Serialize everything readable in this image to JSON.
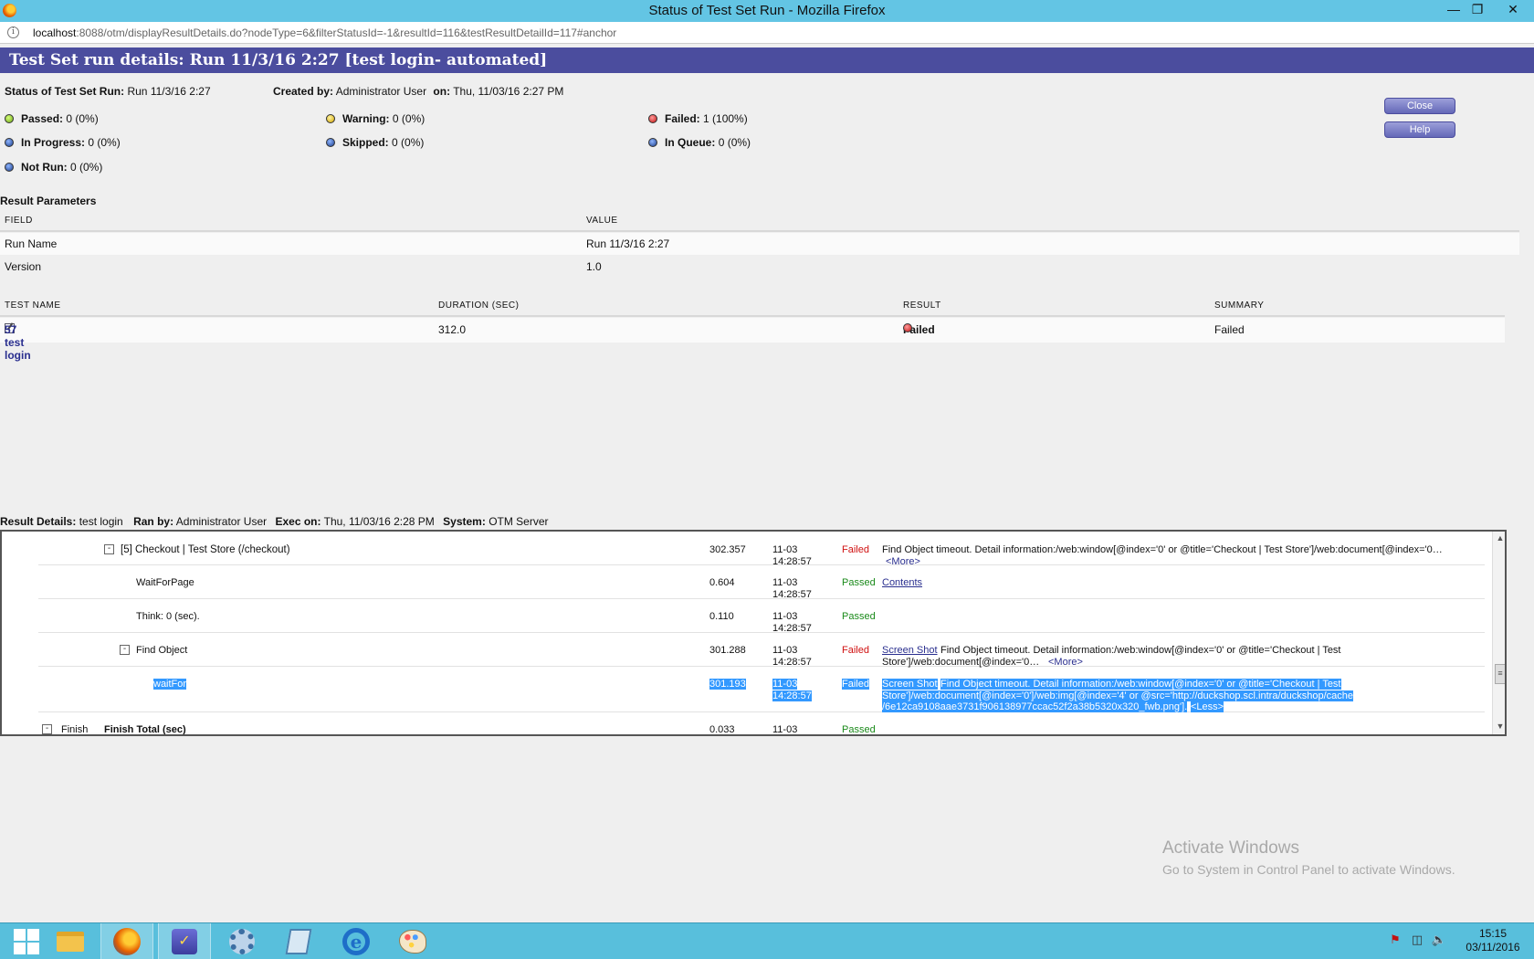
{
  "window": {
    "title": "Status of Test Set Run - Mozilla Firefox",
    "url_host": "localhost",
    "url_rest": ":8088/otm/displayResultDetails.do?nodeType=6&filterStatusId=-1&resultId=116&testResultDetailId=117#anchor"
  },
  "page": {
    "heading": "Test Set run details: Run 11/3/16 2:27 [test login- automated]",
    "status_label": "Status of Test Set Run:",
    "status_value": "Run 11/3/16 2:27",
    "created_label": "Created by:",
    "created_value": "Administrator User",
    "on_label": "on:",
    "on_value": "Thu, 11/03/16 2:27 PM"
  },
  "stats": [
    {
      "label": "Passed:",
      "value": "0 (0%)",
      "color": "#6fa818"
    },
    {
      "label": "Warning:",
      "value": "0 (0%)",
      "color": "#d2a400"
    },
    {
      "label": "Failed:",
      "value": "1 (100%)",
      "color": "#c21313"
    },
    {
      "label": "In Progress:",
      "value": "0 (0%)",
      "color": "#1b3d8a"
    },
    {
      "label": "Skipped:",
      "value": "0 (0%)",
      "color": "#1b3d8a"
    },
    {
      "label": "In Queue:",
      "value": "0 (0%)",
      "color": "#1b3d8a"
    },
    {
      "label": "Not Run:",
      "value": "0 (0%)",
      "color": "#1b3d8a"
    }
  ],
  "buttons": {
    "close": "Close",
    "help": "Help"
  },
  "params": {
    "title": "Result Parameters",
    "headers": [
      "FIELD",
      "VALUE"
    ],
    "rows": [
      {
        "field": "Run Name",
        "value": "Run 11/3/16 2:27"
      },
      {
        "field": "Version",
        "value": "1.0"
      }
    ]
  },
  "tests": {
    "headers": [
      "TEST NAME",
      "DURATION (SEC)",
      "RESULT",
      "SUMMARY"
    ],
    "rows": [
      {
        "name": "57 test login",
        "duration": "312.0",
        "result": "Failed",
        "summary": "Failed"
      }
    ]
  },
  "result_details": {
    "details_label": "Result Details:",
    "details_value": "test login",
    "ran_label": "Ran by:",
    "ran_value": "Administrator User",
    "exec_label": "Exec on:",
    "exec_value": "Thu, 11/03/16 2:28 PM",
    "system_label": "System:",
    "system_value": "OTM Server",
    "rows": [
      {
        "toggle": "-",
        "name": "[5] Checkout | Test Store (/checkout)",
        "duration": "302.357",
        "date": "11-03",
        "time": "14:28:57",
        "status": "Failed",
        "message": "Find Object timeout. Detail information:/web:window[@index='0' or @title='Checkout | Test Store']/web:document[@index='0…",
        "more": "<More>"
      },
      {
        "name": "WaitForPage",
        "duration": "0.604",
        "date": "11-03",
        "time": "14:28:57",
        "status": "Passed",
        "link": "Contents"
      },
      {
        "name": "Think: 0 (sec).",
        "duration": "0.110",
        "date": "11-03",
        "time": "14:28:57",
        "status": "Passed"
      },
      {
        "toggle": "-",
        "name": "Find Object",
        "duration": "301.288",
        "date": "11-03",
        "time": "14:28:57",
        "status": "Failed",
        "link": "Screen Shot",
        "message_l1": "Find Object timeout. Detail information:/web:window[@index='0' or @title='Checkout | Test",
        "message_l2": "Store']/web:document[@index='0…",
        "more": "<More>"
      },
      {
        "name": "waitFor",
        "duration": "301.193",
        "date": "11-03",
        "time": "14:28:57",
        "status": "Failed",
        "link": "Screen Shot",
        "message_l1": "Find Object timeout. Detail information:/web:window[@index='0' or @title='Checkout | Test",
        "message_l2": "Store']/web:document[@index='0']/web:img[@index='4' or @src='http://duckshop.scl.intra/duckshop/cache",
        "message_l3": "/6e12ca9108aae3731f906138977ccac52f2a38b5320x320_fwb.png'].",
        "less": "<Less>"
      },
      {
        "toggle": "-",
        "label": "Finish",
        "name": "Finish Total (sec)",
        "duration": "0.033",
        "date": "11-03",
        "status": "Passed"
      }
    ]
  },
  "watermark": {
    "line1": "Activate Windows",
    "line2": "Go to System in Control Panel to activate Windows."
  },
  "taskbar": {
    "time": "15:15",
    "date": "03/11/2016",
    "items": [
      "start-icon",
      "file-explorer-icon",
      "firefox-icon",
      "otm-icon",
      "settings-gear-icon",
      "document-app-icon",
      "internet-explorer-icon",
      "paint-icon"
    ]
  }
}
